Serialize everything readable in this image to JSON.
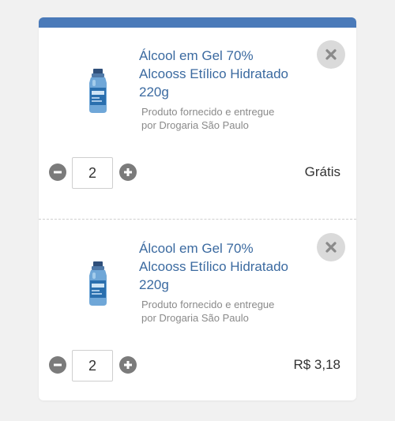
{
  "colors": {
    "accent": "#4a7ab9",
    "title": "#3b6aa0",
    "seller": "#8a8a8a",
    "button": "#7b7b7b"
  },
  "icons": {
    "remove": "close-icon",
    "decrement": "minus-icon",
    "increment": "plus-icon"
  },
  "cart": {
    "items": [
      {
        "title": "Álcool em Gel 70% Alcooss Etílico Hidratado 220g",
        "seller": "Produto fornecido e entregue por Drogaria São Paulo",
        "quantity": "2",
        "price": "Grátis"
      },
      {
        "title": "Álcool em Gel 70% Alcooss Etílico Hidratado 220g",
        "seller": "Produto fornecido e entregue por Drogaria São Paulo",
        "quantity": "2",
        "price": "R$ 3,18"
      }
    ]
  }
}
